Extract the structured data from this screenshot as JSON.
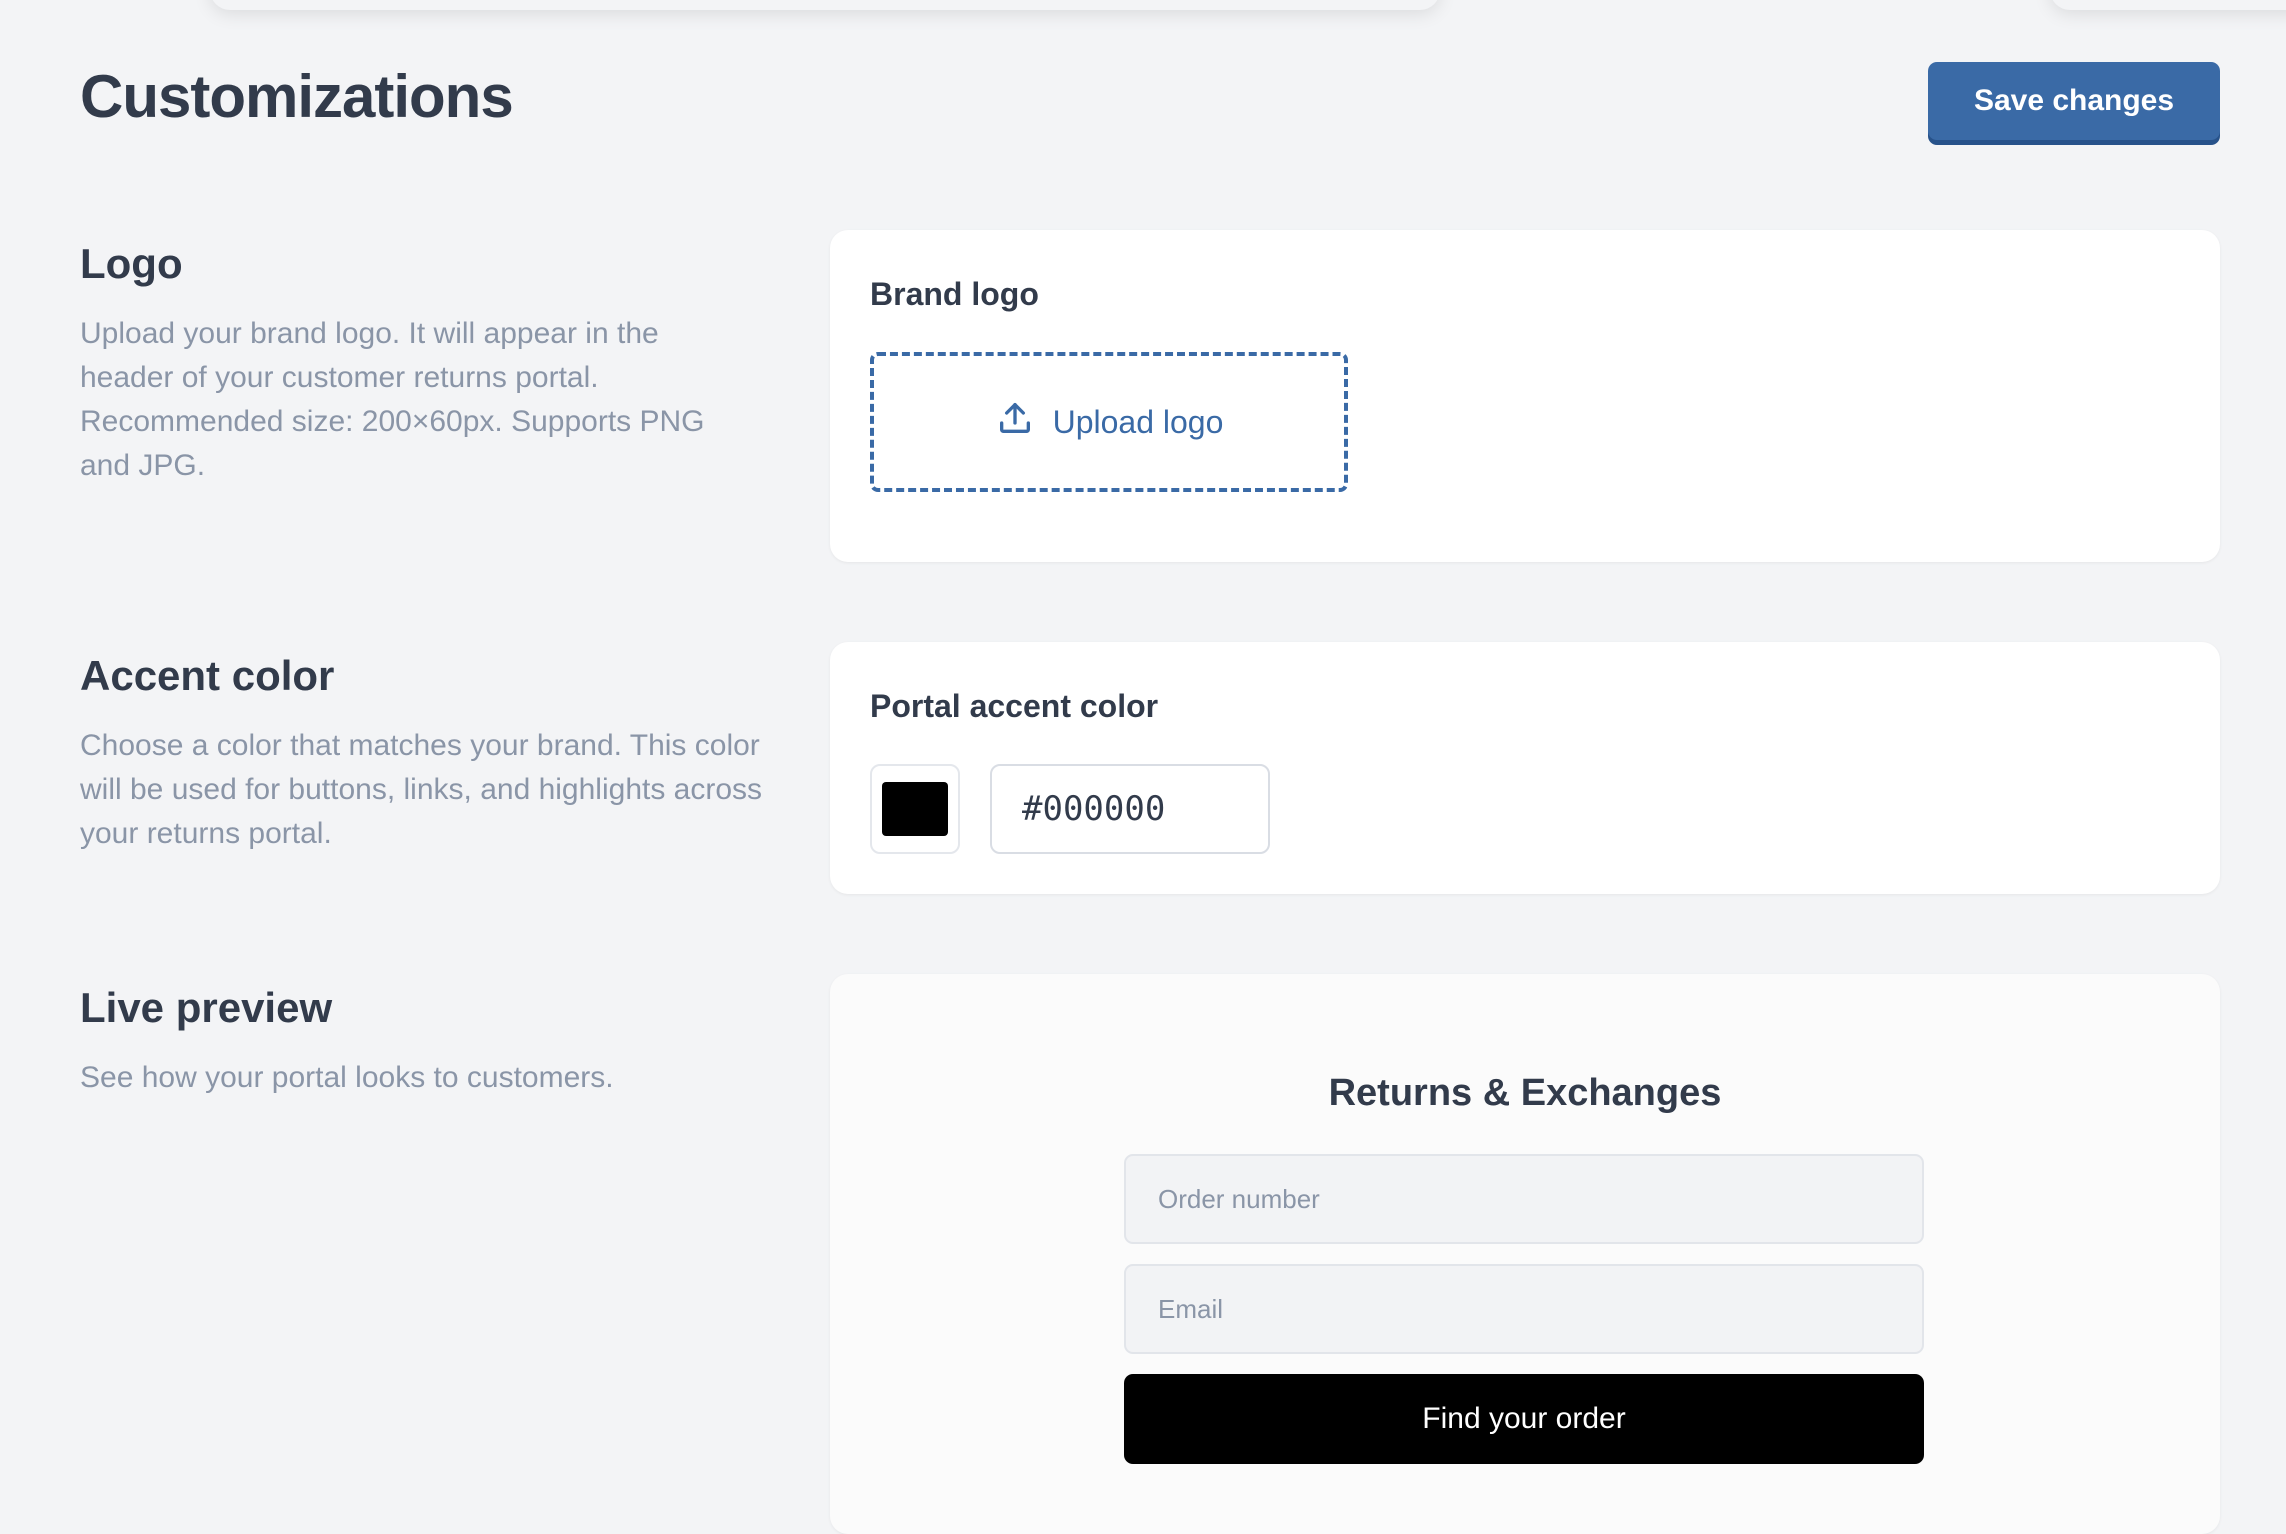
{
  "header": {
    "title": "Customizations",
    "save_label": "Save changes"
  },
  "logo_section": {
    "title": "Logo",
    "description": "Upload your brand logo. It will appear in the header of your customer returns portal. Recommended size: 200×60px. Supports PNG and JPG.",
    "card_label": "Brand logo",
    "upload_label": "Upload logo",
    "upload_icon": "upload-icon"
  },
  "accent_section": {
    "title": "Accent color",
    "description": "Choose a color that matches your brand. This color will be used for buttons, links, and highlights across your returns portal.",
    "card_label": "Portal accent color",
    "color_value": "#000000"
  },
  "preview_section": {
    "title": "Live preview",
    "description": "See how your portal looks to customers.",
    "portal_title": "Returns & Exchanges",
    "order_placeholder": "Order number",
    "email_placeholder": "Email",
    "button_label": "Find your order"
  },
  "colors": {
    "primary": "#3a6aa6",
    "accent": "#000000",
    "background": "#f3f4f6"
  }
}
